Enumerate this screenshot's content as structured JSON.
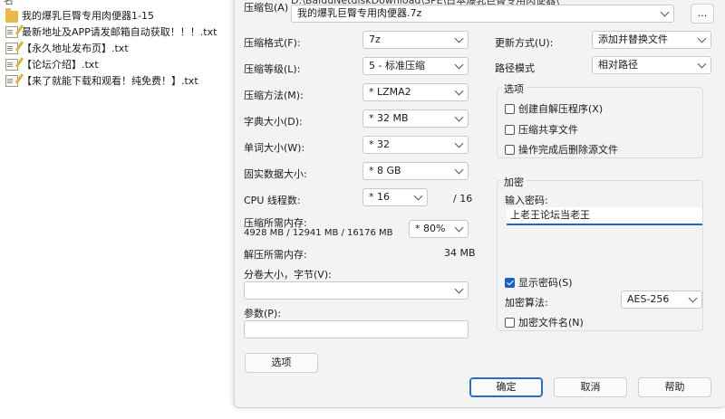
{
  "file_list": {
    "top_cut_text": "名",
    "items": [
      {
        "icon": "folder-icon",
        "name": "我的爆乳巨臀专用肉便器1-15"
      },
      {
        "icon": "text-file-icon",
        "name": "最新地址及APP请发邮箱自动获取！！！.txt"
      },
      {
        "icon": "text-file-icon",
        "name": "【永久地址发布页】.txt"
      },
      {
        "icon": "text-file-icon",
        "name": "【论坛介绍】.txt"
      },
      {
        "icon": "text-file-icon",
        "name": "【来了就能下载和观看！纯免费！】.txt"
      }
    ]
  },
  "dialog": {
    "archive_label": "压缩包(A)",
    "archive_path_cut": "D:\\BaiduNetdiskDownload\\SPE\\日本爆乳巨臀专用肉便器\\",
    "archive_name": "我的爆乳巨臀专用肉便器.7z",
    "browse_label": "...",
    "left": {
      "format_label": "压缩格式(F):",
      "format_value": "7z",
      "level_label": "压缩等级(L):",
      "level_value": "5 - 标准压缩",
      "method_label": "压缩方法(M):",
      "method_value": "* LZMA2",
      "dict_label": "字典大小(D):",
      "dict_value": "* 32 MB",
      "word_label": "单词大小(W):",
      "word_value": "* 32",
      "solid_label": "固实数据大小:",
      "solid_value": "* 8 GB",
      "cpu_label": "CPU 线程数:",
      "cpu_value": "* 16",
      "cpu_total": "/ 16",
      "mem_comp_label": "压缩所需内存:",
      "mem_comp_value": "4928 MB / 12941 MB / 16176 MB",
      "mem_percent": "* 80%",
      "mem_decomp_label": "解压所需内存:",
      "mem_decomp_value": "34 MB",
      "volume_label": "分卷大小，字节(V):",
      "volume_value": "",
      "params_label": "参数(P):",
      "params_value": "",
      "options_button": "选项"
    },
    "right": {
      "update_label": "更新方式(U):",
      "update_value": "添加并替换文件",
      "path_label": "路径模式",
      "path_value": "相对路径",
      "options_group": "选项",
      "opt_sfx": "创建自解压程序(X)",
      "opt_shared": "压缩共享文件",
      "opt_delete": "操作完成后删除源文件",
      "encrypt_group": "加密",
      "password_label": "输入密码:",
      "password_value": "上老王论坛当老王",
      "show_password": "显示密码(S)",
      "enc_method_label": "加密算法:",
      "enc_method_value": "AES-256",
      "encrypt_names": "加密文件名(N)"
    },
    "buttons": {
      "ok": "确定",
      "cancel": "取消",
      "help": "帮助"
    }
  }
}
